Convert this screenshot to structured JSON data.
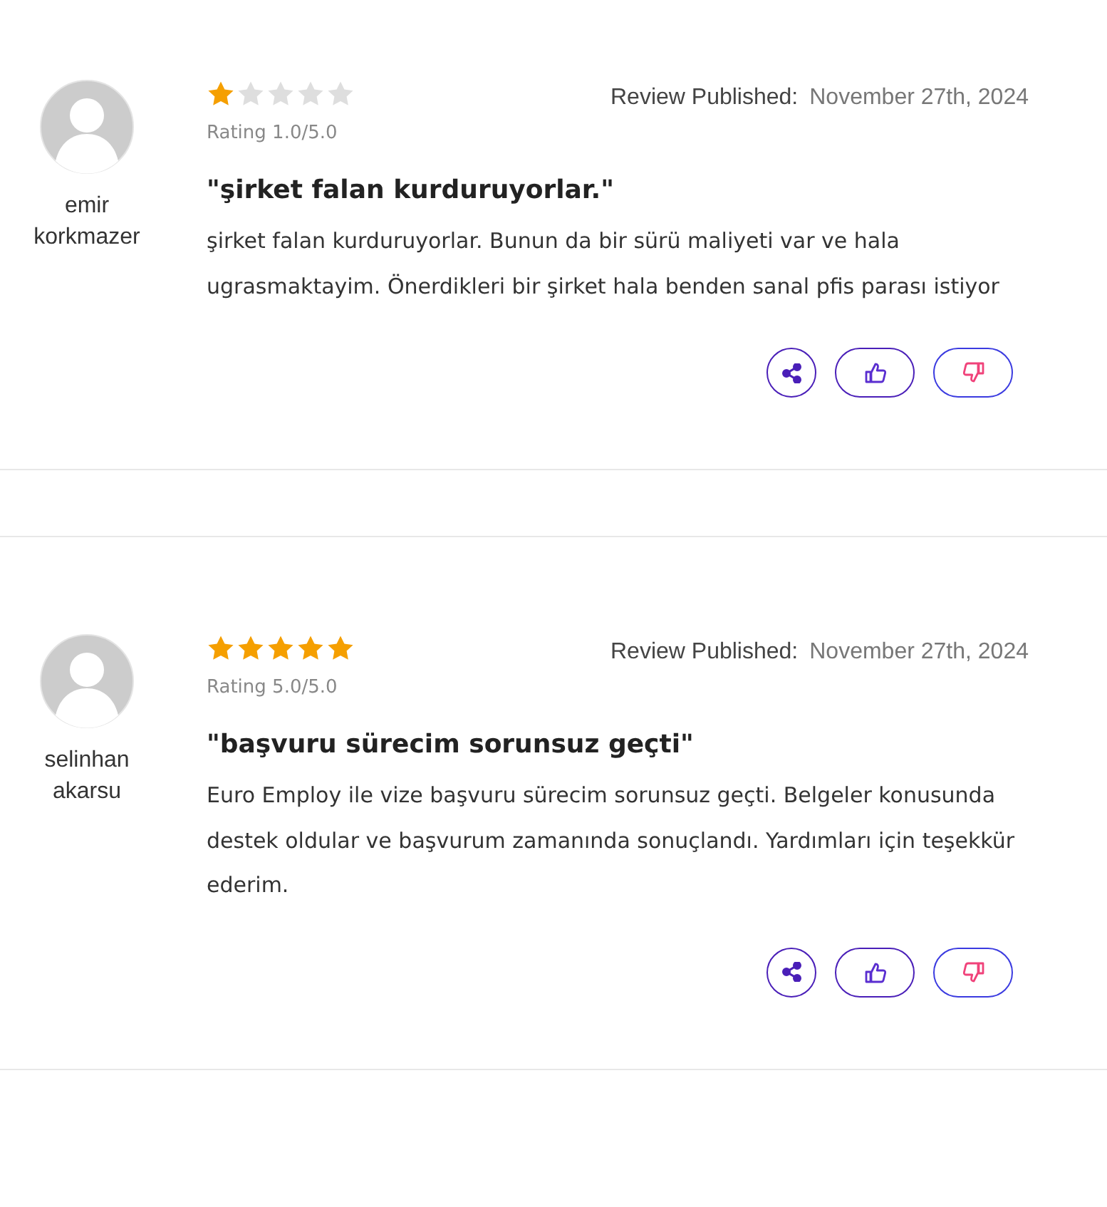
{
  "reviews": [
    {
      "author": "emir korkmazer",
      "stars": 1,
      "rating": "Rating 1.0/5.0",
      "published_label": "Review Published:",
      "date": "November 27th, 2024",
      "title": "\"şirket falan kurduruyorlar.\"",
      "body": "şirket falan kurduruyorlar. Bunun da bir sürü maliyeti var ve hala ugrasmaktayim. Önerdikleri bir şirket hala benden sanal pfis parası istiyor"
    },
    {
      "author": "selinhan akarsu",
      "stars": 5,
      "rating": "Rating 5.0/5.0",
      "published_label": "Review Published:",
      "date": "November 27th, 2024",
      "title": "\"başvuru sürecim sorunsuz geçti\"",
      "body": "Euro Employ ile vize başvuru sürecim sorunsuz geçti. Belgeler konusunda destek oldular ve başvurum zamanında sonuçlandı. Yardımları için teşekkür ederim."
    }
  ]
}
